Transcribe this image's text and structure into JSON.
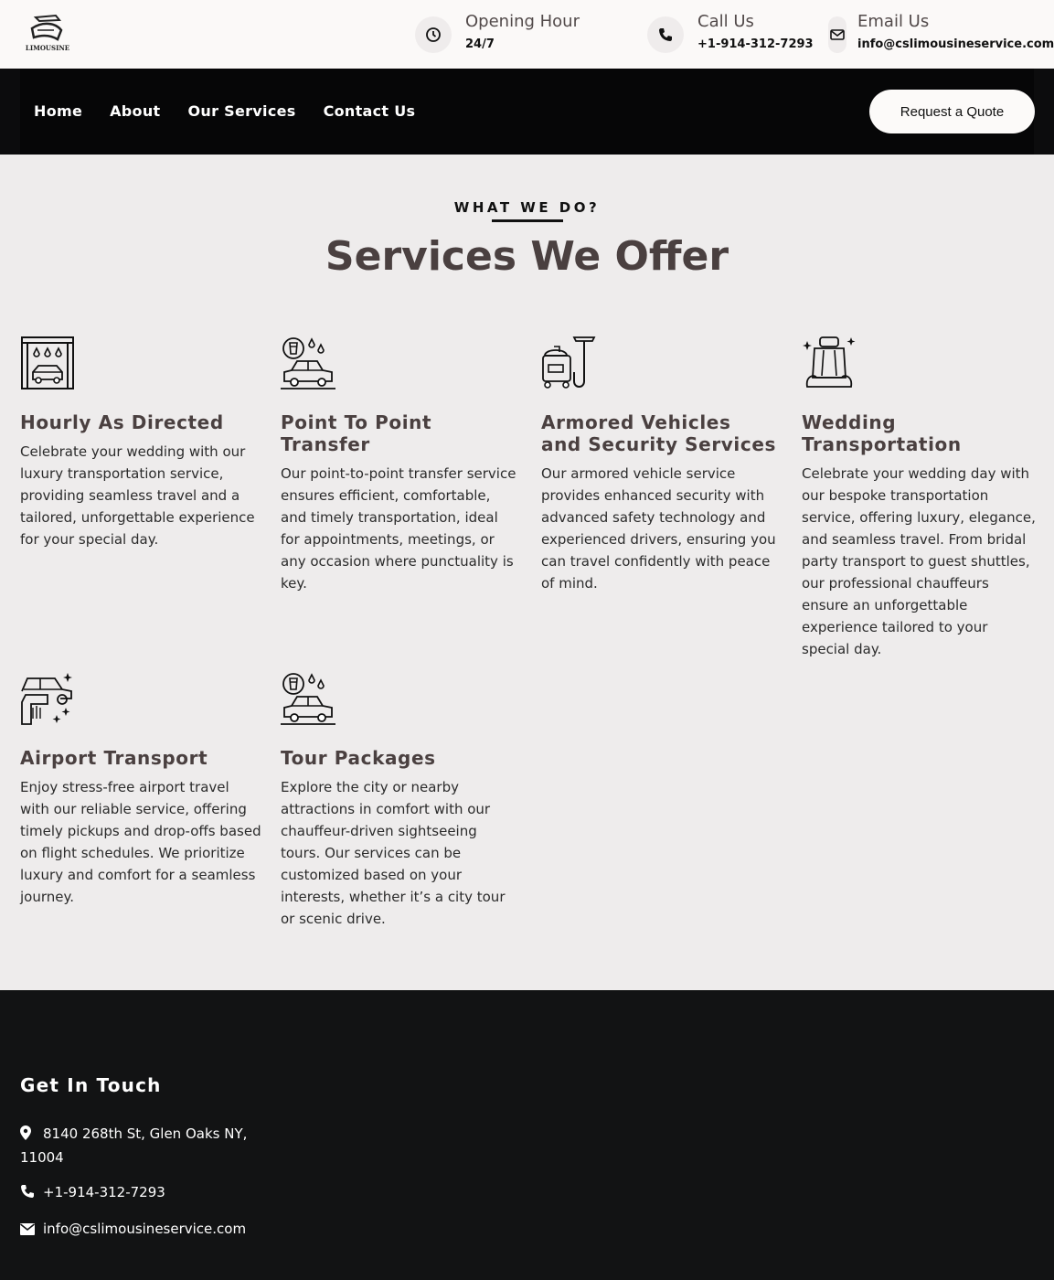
{
  "brand": {
    "logo_text": "LIMOUSINE"
  },
  "topbar": {
    "opening": {
      "title": "Opening Hour",
      "value": "24/7",
      "icon": "clock-icon"
    },
    "call": {
      "title": "Call Us",
      "value": "+1-914-312-7293",
      "icon": "phone-icon"
    },
    "email": {
      "title": "Email Us",
      "value": "info@cslimousineservice.com",
      "icon": "envelope-icon"
    }
  },
  "nav": {
    "items": [
      "Home",
      "About",
      "Our Services",
      "Contact Us"
    ],
    "cta": "Request a Quote"
  },
  "services": {
    "eyebrow": "WHAT WE DO?",
    "title": "Services We Offer",
    "items": [
      {
        "title": "Hourly As Directed",
        "icon": "car-wash-icon",
        "text": "Celebrate your wedding with our luxury transportation service, providing seamless travel and a tailored, unforgettable experience for your special day."
      },
      {
        "title": "Point To Point Transfer",
        "icon": "car-with-drops-icon",
        "text": "Our point-to-point transfer service ensures efficient, comfortable, and timely transportation, ideal for appointments, meetings, or any occasion where punctuality is key."
      },
      {
        "title": "Armored Vehicles and Security Services",
        "icon": "vacuum-cleaner-icon",
        "text": "Our armored vehicle service provides enhanced security with advanced safety technology and experienced drivers, ensuring you can travel confidently with peace of mind."
      },
      {
        "title": "Wedding Transportation",
        "icon": "car-seat-icon",
        "text": "Celebrate your wedding day with our bespoke transportation service, offering luxury, elegance, and seamless travel. From bridal party transport to guest shuttles, our professional chauffeurs ensure an unforgettable experience tailored to your special day."
      },
      {
        "title": "Airport Transport",
        "icon": "car-polish-icon",
        "text": "Enjoy stress-free airport travel with our reliable service, offering timely pickups and drop-offs based on flight schedules. We prioritize luxury and comfort for a seamless journey."
      },
      {
        "title": "Tour Packages",
        "icon": "car-with-drops-icon",
        "text": "Explore the city or nearby attractions in comfort with our chauffeur-driven sightseeing tours. Our services can be customized based on your interests, whether it’s a city tour or scenic drive."
      }
    ]
  },
  "footer": {
    "title": "Get In Touch",
    "address": "8140 268th St, Glen Oaks NY, 11004",
    "phone": "+1-914-312-7293",
    "email": "info@cslimousineservice.com"
  }
}
